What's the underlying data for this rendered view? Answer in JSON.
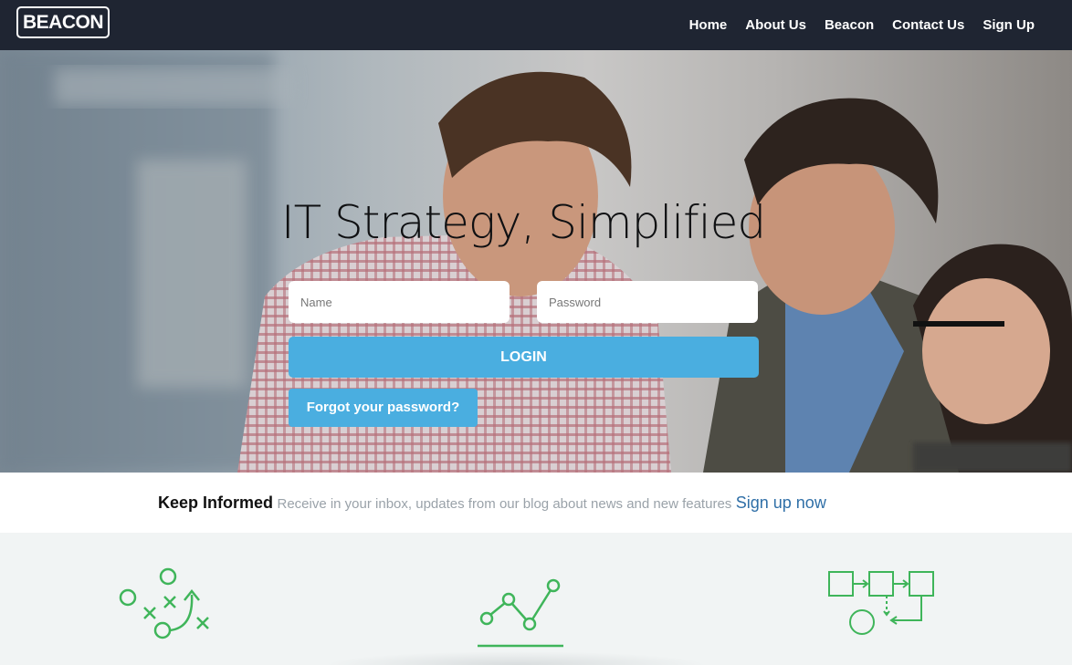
{
  "brand": {
    "logo": "BEACON"
  },
  "nav": {
    "items": [
      {
        "label": "Home"
      },
      {
        "label": "About Us"
      },
      {
        "label": "Beacon"
      },
      {
        "label": "Contact Us"
      },
      {
        "label": "Sign Up"
      }
    ]
  },
  "hero": {
    "title": "IT Strategy, Simplified",
    "name_placeholder": "Name",
    "password_placeholder": "Password",
    "login_label": "LOGIN",
    "forgot_label": "Forgot your password?"
  },
  "inform": {
    "title": "Keep Informed",
    "text": "Receive in your inbox, updates from our blog about news and new features",
    "link": "Sign up now"
  },
  "features": {
    "icons": [
      "strategy-play-icon",
      "line-chart-icon",
      "process-flow-icon"
    ]
  },
  "colors": {
    "navbar": "#1f2532",
    "accent_button": "#4aaee0",
    "link": "#2f6fa7",
    "icon_green": "#3fb55a"
  }
}
